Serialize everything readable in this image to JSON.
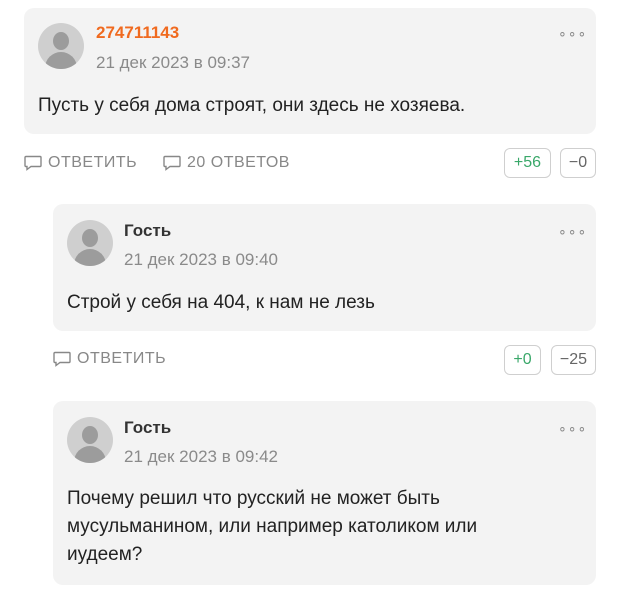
{
  "comments": [
    {
      "author": "274711143",
      "date": "21 дек 2023 в 09:37",
      "text": "Пусть у себя дома строят, они здесь не хозяева.",
      "reply_label": "ОТВЕТИТЬ",
      "replies_label": "20 ОТВЕТОВ",
      "votes_up": "+56",
      "votes_down": "−0"
    },
    {
      "author": "Гость",
      "date": "21 дек 2023 в 09:40",
      "text": "Строй у себя на 404, к нам не лезь",
      "reply_label": "ОТВЕТИТЬ",
      "votes_up": "+0",
      "votes_down": "−25"
    },
    {
      "author": "Гость",
      "date": "21 дек 2023 в 09:42",
      "text_lines": [
        "Почему решил что русский не может быть",
        "мусульманином, или например католиком или",
        "иудеем?"
      ]
    }
  ],
  "menu_glyph": "∘∘∘",
  "colors": {
    "author_highlight": "#f06a1f",
    "vote_up": "#3aa86a",
    "card_bg": "#f3f3f3"
  }
}
